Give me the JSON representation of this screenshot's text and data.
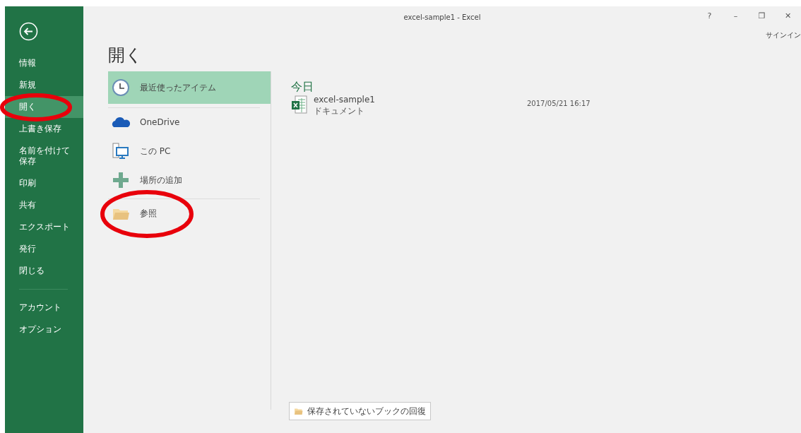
{
  "window": {
    "title": "excel-sample1 - Excel",
    "controls": [
      "?",
      "–",
      "❐",
      "✕"
    ],
    "account": "サインイン"
  },
  "sidebar": {
    "groups": [
      [
        {
          "label": "情報",
          "selected": false,
          "circled": false
        },
        {
          "label": "新規",
          "selected": false,
          "circled": false
        },
        {
          "label": "開く",
          "selected": true,
          "circled": true
        },
        {
          "label": "上書き保存",
          "selected": false,
          "circled": false
        },
        {
          "label": "名前を付けて保存",
          "selected": false,
          "circled": false
        },
        {
          "label": "印刷",
          "selected": false,
          "circled": false
        },
        {
          "label": "共有",
          "selected": false,
          "circled": false
        },
        {
          "label": "エクスポート",
          "selected": false,
          "circled": false
        },
        {
          "label": "発行",
          "selected": false,
          "circled": false
        },
        {
          "label": "閉じる",
          "selected": false,
          "circled": false
        }
      ],
      [
        {
          "label": "アカウント",
          "selected": false,
          "circled": false
        },
        {
          "label": "オプション",
          "selected": false,
          "circled": false
        }
      ]
    ]
  },
  "heading": "開く",
  "places": [
    [
      {
        "kind": "clock",
        "label": "最近使ったアイテム",
        "selected": true,
        "circled": false
      }
    ],
    [
      {
        "kind": "cloud",
        "label": "OneDrive",
        "selected": false,
        "circled": false
      },
      {
        "kind": "pc",
        "label": "この PC",
        "selected": false,
        "circled": false
      },
      {
        "kind": "add",
        "label": "場所の追加",
        "selected": false,
        "circled": false
      }
    ],
    [
      {
        "kind": "folder",
        "label": "参照",
        "selected": false,
        "circled": true
      }
    ]
  ],
  "recent": {
    "group": "今日",
    "files": [
      {
        "name": "excel-sample1",
        "location": "ドキュメント",
        "modified": "2017/05/21 16:17"
      }
    ]
  },
  "recover_button": "保存されていないブックの回復"
}
